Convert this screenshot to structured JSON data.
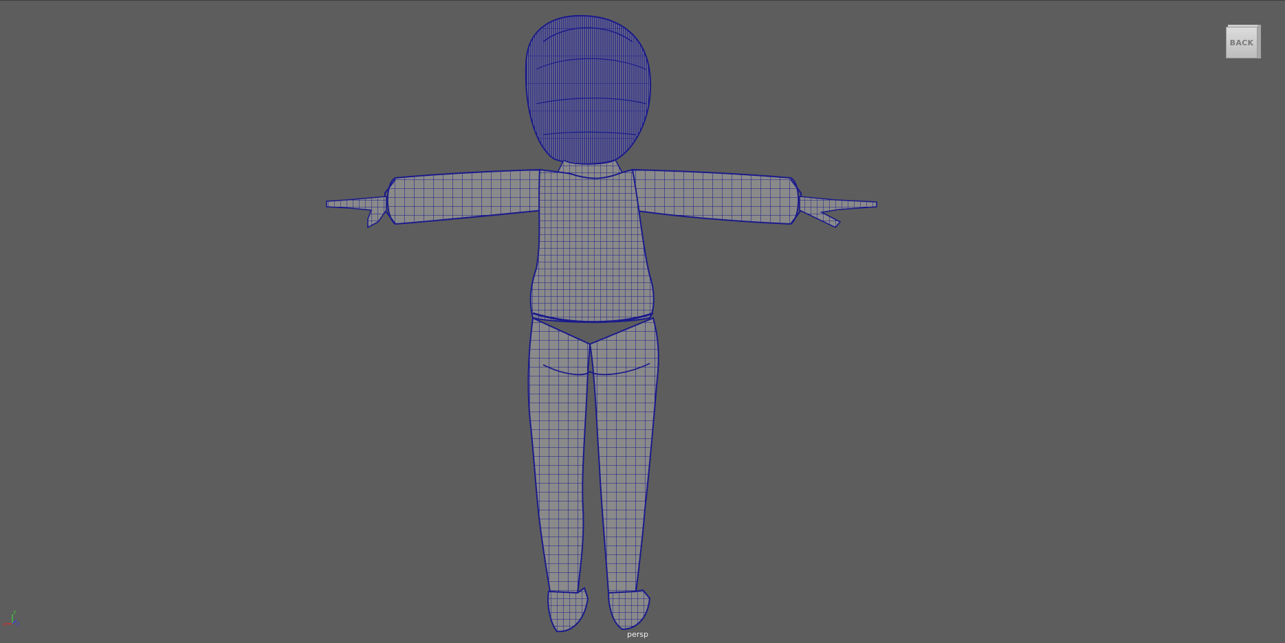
{
  "viewport": {
    "camera_label": "persp",
    "viewcube_face": "BACK",
    "axis_labels": {
      "x": "x",
      "y": "y",
      "z": "z"
    },
    "background_color": "#5d5d5d",
    "wireframe_color": "#1a1a8c",
    "model_shaded_color": "#8a8a8a"
  }
}
